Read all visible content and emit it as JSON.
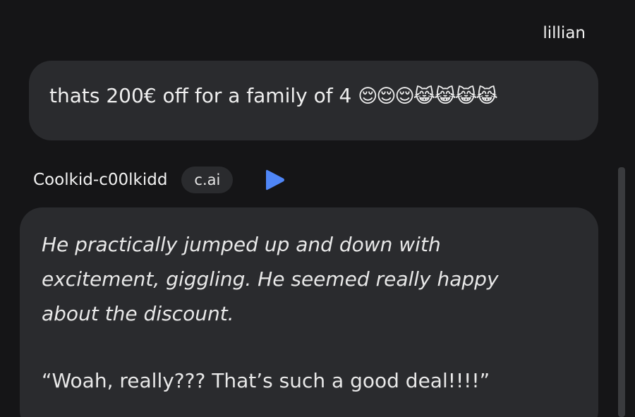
{
  "user_message": {
    "author": "lillian",
    "text": "thats 200€ off for a family of 4",
    "emojis": "😌😌😌😹😹😹😹"
  },
  "bot_message": {
    "author": "Coolkid-c00lkidd",
    "badge": "c.ai",
    "narration": "He practically jumped up and down with excitement, giggling. He seemed really happy about the discount.",
    "dialogue": "“Woah, really??? That’s such a good deal!!!!”"
  },
  "colors": {
    "background": "#151517",
    "bubble": "#2a2b2e",
    "play_accent": "#4f86f7"
  },
  "icons": {
    "play": "play-icon"
  }
}
